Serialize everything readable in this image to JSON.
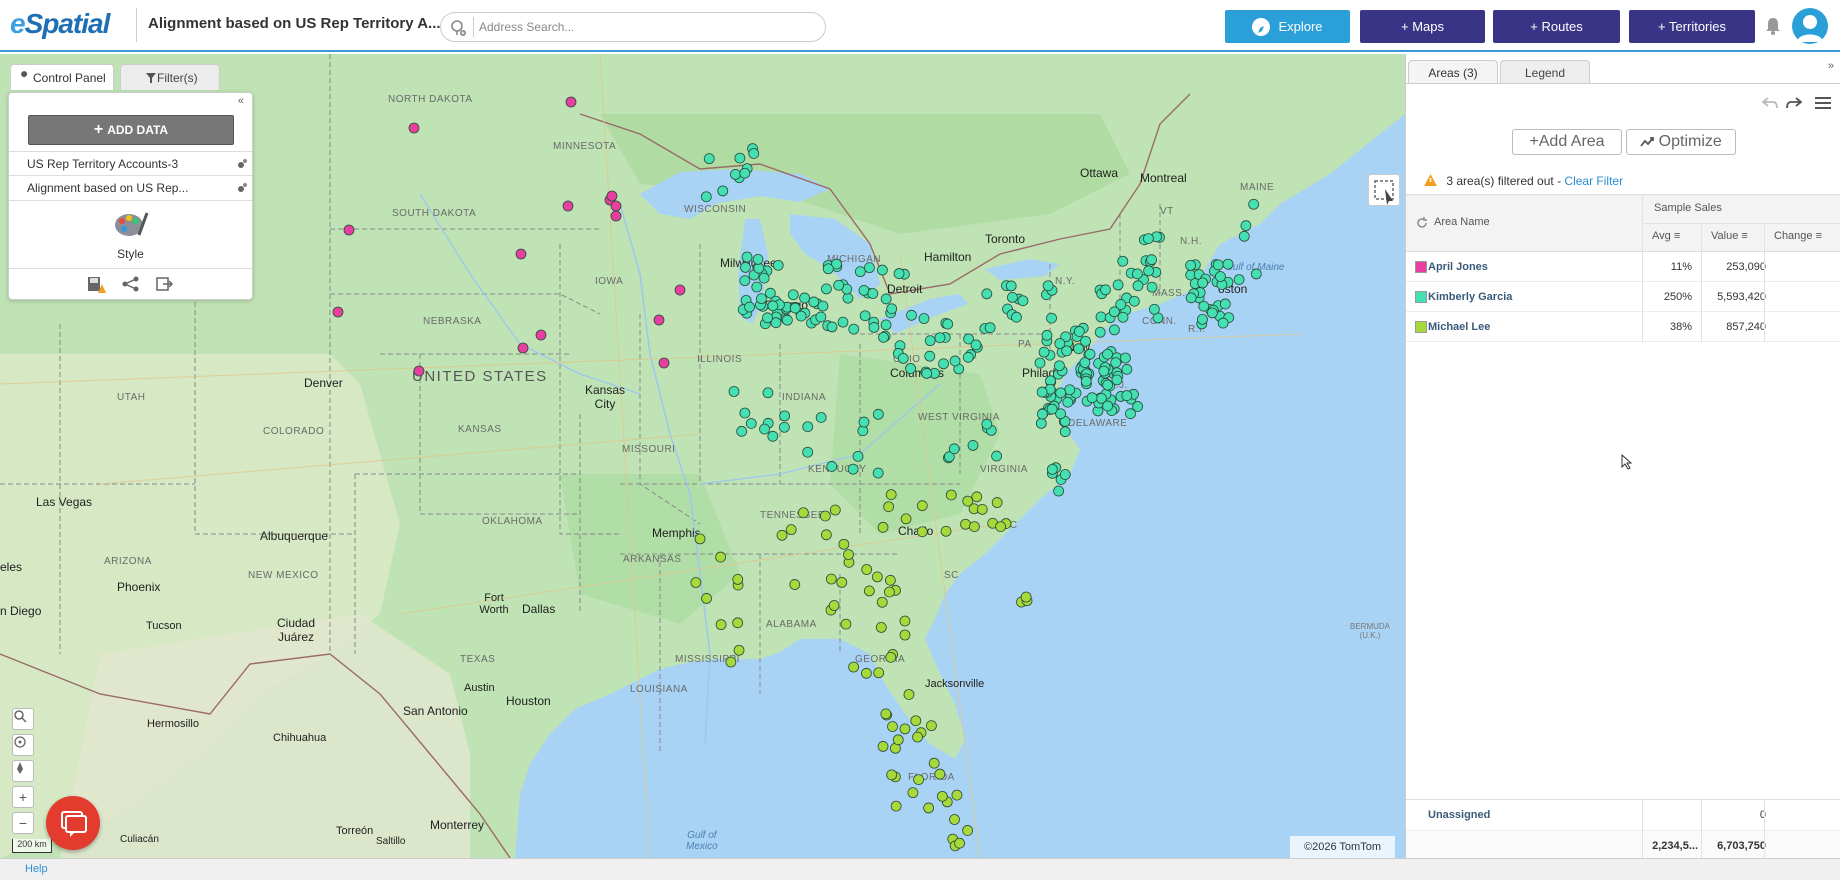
{
  "header": {
    "logo_prefix": "e",
    "logo_text": "Spatial",
    "map_title": "Alignment based on US Rep Territory A...",
    "search_placeholder": "Address Search...",
    "buttons": {
      "explore": "Explore",
      "maps": "+ Maps",
      "routes": "+ Routes",
      "territories": "+ Territories"
    }
  },
  "control_panel": {
    "tab_control": "Control Panel",
    "tab_filters": "Filter(s)",
    "add_data_label": "ADD DATA",
    "layers": [
      "US Rep Territory Accounts-3",
      "Alignment based on US Rep..."
    ],
    "style_label": "Style"
  },
  "map": {
    "copyright": "©2026 TomTom",
    "scale_label": "200 km",
    "labels": {
      "north_dakota": "NORTH DAKOTA",
      "minnesota": "MINNESOTA",
      "south_dakota": "SOUTH DAKOTA",
      "wisconsin": "WISCONSIN",
      "michigan": "MICHIGAN",
      "iowa": "IOWA",
      "nebraska": "NEBRASKA",
      "illinois": "ILLINOIS",
      "indiana": "INDIANA",
      "ohio": "OHIO",
      "pa": "PA",
      "ny": "N.Y.",
      "utah": "UTAH",
      "colorado": "COLORADO",
      "kansas": "KANSAS",
      "missouri": "MISSOURI",
      "kentucky": "KENTUCKY",
      "west_virginia": "WEST VIRGINIA",
      "virginia": "VIRGINIA",
      "tennessee": "TENNESSEE",
      "nc": "NC",
      "sc": "SC",
      "arizona": "ARIZONA",
      "new_mexico": "NEW MEXICO",
      "oklahoma": "OKLAHOMA",
      "arkansas": "ARKANSAS",
      "mississippi": "MISSISSIPPI",
      "alabama": "ALABAMA",
      "georgia": "GEORGIA",
      "texas": "TEXAS",
      "louisiana": "LOUISIANA",
      "florida": "FLORIDA",
      "maine": "MAINE",
      "vt": "VT",
      "nh": "N.H.",
      "mass": "MASS.",
      "conn": "CONN.",
      "ri": "R.I.",
      "nj": "N.J.",
      "delaware": "DELAWARE",
      "united_states": "UNITED STATES",
      "ottawa": "Ottawa",
      "montreal": "Montreal",
      "toronto": "Toronto",
      "hamilton": "Hamilton",
      "milwaukee": "Milwaukee",
      "chicago": "Chicago",
      "detroit": "Detroit",
      "columbus": "Columbus",
      "denver": "Denver",
      "kansas_city": "Kansas City",
      "las_vegas": "Las Vegas",
      "albuquerque": "Albuquerque",
      "memphis": "Memphis",
      "charlotte": "Charlo",
      "phoenix": "Phoenix",
      "dallas": "Dallas",
      "fort_worth": "Fort Worth",
      "tucson": "Tucson",
      "ciudad_juarez": "Ciudad Juárez",
      "austin": "Austin",
      "houston": "Houston",
      "san_antonio": "San Antonio",
      "jacksonville": "Jacksonville",
      "hermosillo": "Hermosillo",
      "chihuahua": "Chihuahua",
      "monterrey": "Monterrey",
      "torreon": "Torreón",
      "saltillo": "Saltillo",
      "culiacan": "Culiacán",
      "san_diego": "n Diego",
      "boston": "oston",
      "philadelphia": "Philad",
      "new_york": "New",
      "eles": "eles",
      "gulf_of_maine": "Gulf of Maine",
      "gulf_of_mexico": "Gulf of\nMexico",
      "bermuda": "BERMUDA\n(U.K.)"
    }
  },
  "right_panel": {
    "tab_areas": "Areas (3)",
    "tab_legend": "Legend",
    "add_area": "Add Area",
    "optimize": "Optimize",
    "filter_warning": "3 area(s) filtered out - ",
    "clear_filter": "Clear Filter",
    "col_area_name": "Area Name",
    "col_group": "Sample Sales",
    "col_avg": "Avg",
    "col_value": "Value",
    "col_change": "Change",
    "rows": [
      {
        "name": "April Jones",
        "color": "#e83e9f",
        "avg": "11%",
        "value": "253,090"
      },
      {
        "name": "Kimberly Garcia",
        "color": "#44e0b2",
        "avg": "250%",
        "value": "5,593,420"
      },
      {
        "name": "Michael Lee",
        "color": "#a6d93a",
        "avg": "38%",
        "value": "857,240"
      }
    ],
    "unassigned_label": "Unassigned",
    "unassigned_value": "0",
    "total_avg": "2,234,5...",
    "total_value": "6,703,750"
  },
  "status": {
    "help": "Help"
  },
  "colors": {
    "accent": "#2b9fd8",
    "nav_button": "#3a3487",
    "pink": "#e83e9f",
    "teal": "#44e0b2",
    "green": "#a6d93a"
  }
}
